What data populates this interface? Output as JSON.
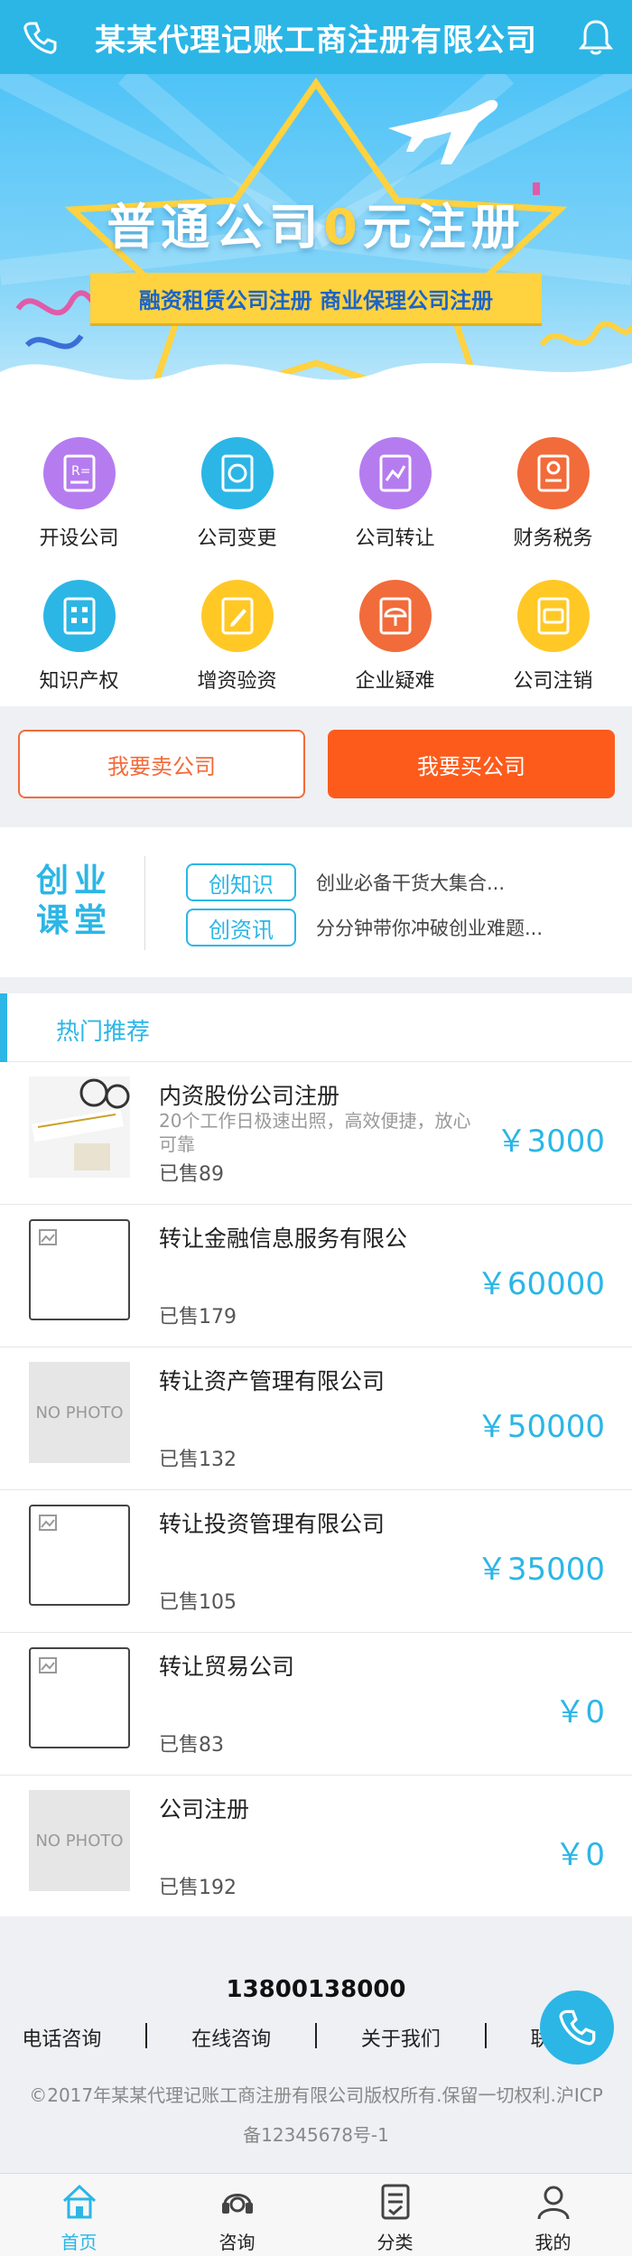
{
  "header": {
    "title": "某某代理记账工商注册有限公司"
  },
  "banner": {
    "headline_pre": "普通公司",
    "headline_zero": "0",
    "headline_post": "元注册",
    "ribbon": "融资租赁公司注册 商业保理公司注册"
  },
  "services": [
    {
      "label": "开设公司",
      "color": "#b57cf0",
      "icon": "document-r-icon"
    },
    {
      "label": "公司变更",
      "color": "#2bb6e6",
      "icon": "refresh-doc-icon"
    },
    {
      "label": "公司转让",
      "color": "#b57cf0",
      "icon": "transfer-doc-icon"
    },
    {
      "label": "财务税务",
      "color": "#f26b3a",
      "icon": "certificate-icon"
    },
    {
      "label": "知识产权",
      "color": "#2bb6e6",
      "icon": "building-icon"
    },
    {
      "label": "增资验资",
      "color": "#ffc825",
      "icon": "edit-doc-icon"
    },
    {
      "label": "企业疑难",
      "color": "#f26b3a",
      "icon": "umbrella-icon"
    },
    {
      "label": "公司注销",
      "color": "#ffc825",
      "icon": "card-icon"
    }
  ],
  "actions": {
    "sell": "我要卖公司",
    "buy": "我要买公司"
  },
  "classroom": {
    "logo_line1": "创业",
    "logo_line2": "课堂",
    "rows": [
      {
        "tag": "创知识",
        "text": "创业必备干货大集合..."
      },
      {
        "tag": "创资讯",
        "text": "分分钟带你冲破创业难题..."
      }
    ]
  },
  "hot": {
    "title": "热门推荐",
    "items": [
      {
        "name": "内资股份公司注册",
        "desc": "20个工作日极速出照，高效便捷，放心可靠",
        "sold": "已售89",
        "price": "￥3000",
        "thumb": "photo"
      },
      {
        "name": "转让金融信息服务有限公",
        "desc": "",
        "sold": "已售179",
        "price": "￥60000",
        "thumb": "broken"
      },
      {
        "name": "转让资产管理有限公司",
        "desc": "",
        "sold": "已售132",
        "price": "￥50000",
        "thumb": "nophoto"
      },
      {
        "name": "转让投资管理有限公司",
        "desc": "",
        "sold": "已售105",
        "price": "￥35000",
        "thumb": "broken"
      },
      {
        "name": "转让贸易公司",
        "desc": "",
        "sold": "已售83",
        "price": "￥0",
        "thumb": "broken"
      },
      {
        "name": "公司注册",
        "desc": "",
        "sold": "已售192",
        "price": "￥0",
        "thumb": "nophoto"
      }
    ],
    "no_photo_text": "NO PHOTO"
  },
  "footer": {
    "phone": "13800138000",
    "links": [
      "电话咨询",
      "在线咨询",
      "关于我们",
      "联系我们"
    ],
    "copyright": "©2017年某某代理记账工商注册有限公司版权所有.保留一切权利.沪ICP备12345678号-1"
  },
  "bottom_nav": [
    {
      "label": "首页",
      "icon": "home-icon",
      "active": true
    },
    {
      "label": "咨询",
      "icon": "headset-icon",
      "active": false
    },
    {
      "label": "分类",
      "icon": "category-icon",
      "active": false
    },
    {
      "label": "我的",
      "icon": "user-icon",
      "active": false
    }
  ],
  "colors": {
    "primary": "#2bb6e6",
    "orange": "#fd5b1c",
    "yellow": "#ffd23f"
  }
}
